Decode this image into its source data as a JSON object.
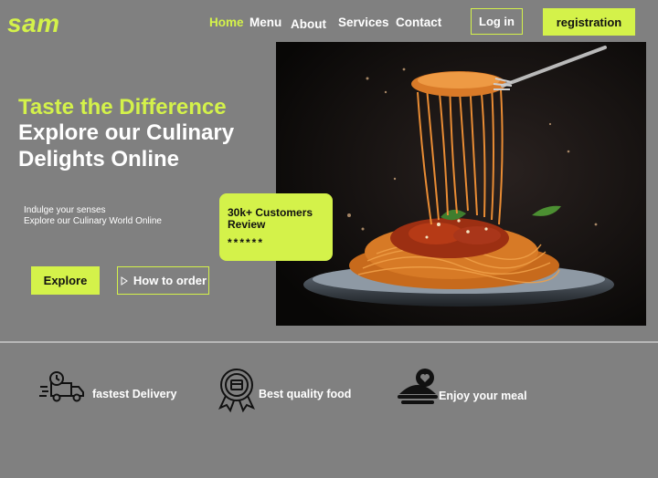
{
  "brand": {
    "logo": "sam"
  },
  "nav": {
    "items": [
      {
        "label": "Home",
        "active": true
      },
      {
        "label": "Menu"
      },
      {
        "label": "About"
      },
      {
        "label": "Services"
      },
      {
        "label": "Contact"
      }
    ],
    "login_label": "Log in",
    "register_label": "registration"
  },
  "hero": {
    "headline_accent": "Taste the Difference",
    "headline_main": "Explore our Culinary Delights Online",
    "subtext_line1": "Indulge your senses",
    "subtext_line2": "Explore our Culinary World Online",
    "explore_label": "Explore",
    "how_label": "How to order"
  },
  "review_card": {
    "title": "30k+ Customers Review",
    "stars": "******"
  },
  "features": [
    {
      "label": "fastest Delivery",
      "icon": "delivery-truck-icon"
    },
    {
      "label": "Best quality food",
      "icon": "quality-badge-icon"
    },
    {
      "label": "Enjoy your meal",
      "icon": "meal-icon"
    }
  ],
  "colors": {
    "accent": "#d4f24a",
    "background": "#808080",
    "hero_dark": "#0d0b0a"
  }
}
